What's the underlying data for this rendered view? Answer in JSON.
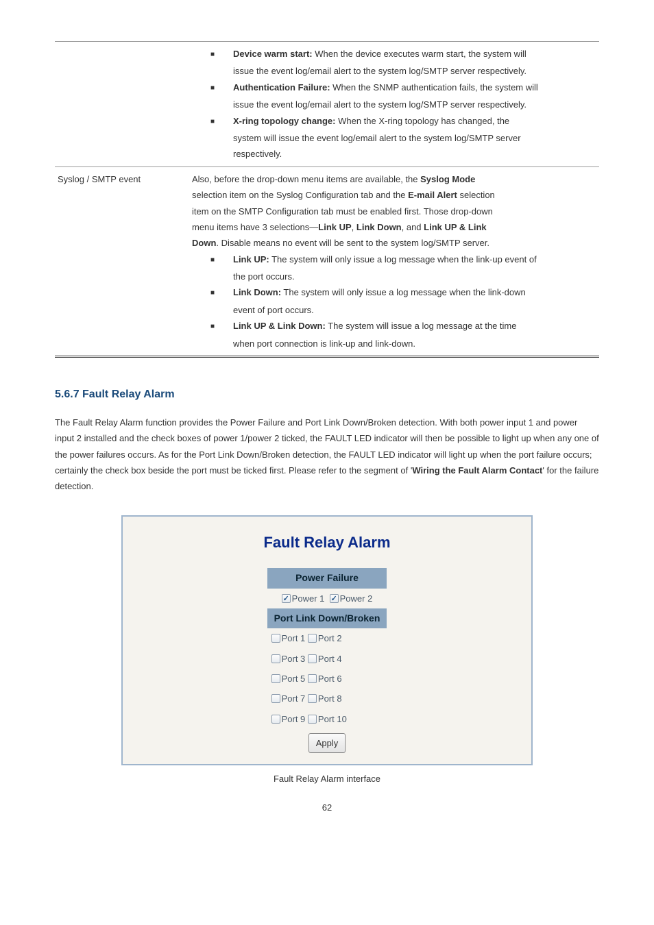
{
  "labelCol1": "",
  "syslogSmtpLabel": "Syslog / SMTP event",
  "row1": {
    "b1_lead": "Device warm start:",
    "b1_tail": " When the device executes warm start, the system will",
    "b1_cont": "issue the event log/email alert to the system log/SMTP server respectively.",
    "b2_lead": "Authentication Failure:",
    "b2_tail": " When the SNMP authentication fails, the system will",
    "b2_cont": "issue the event log/email alert to the system log/SMTP server respectively.",
    "b3_lead": "X-ring topology change:",
    "b3_tail": " When the X-ring topology has changed, the",
    "b3_cont1": "system will issue the event log/email alert to the system log/SMTP server",
    "b3_cont2": "respectively."
  },
  "row2": {
    "p1a": "Also, before the drop-down menu items are available, the ",
    "p1b": "Syslog Mode",
    "p2a": "selection item on the Syslog Configuration tab and the ",
    "p2b": "E-mail Alert",
    "p2c": " selection",
    "p3": "item on the SMTP Configuration tab must be enabled first. Those drop-down",
    "p4a": "menu items have 3 selections—",
    "p4b": "Link UP",
    "p4c": ", ",
    "p4d": "Link Down",
    "p4e": ", and ",
    "p4f": "Link UP & Link",
    "p5a": "Down",
    "p5b": ". Disable means no event will be sent to the system log/SMTP server.",
    "b1_lead": "Link UP:",
    "b1_tail": " The system will only issue a log message when the link-up event of",
    "b1_cont": "the port occurs.",
    "b2_lead": "Link Down:",
    "b2_tail": " The system will only issue a log message when the link-down",
    "b2_cont": "event of port occurs.",
    "b3_lead": "Link UP & Link Down:",
    "b3_tail": " The system will issue a log message at the time",
    "b3_cont": "when port connection is link-up and link-down."
  },
  "heading": "5.6.7 Fault Relay Alarm",
  "bodyPara": {
    "t1": "The Fault Relay Alarm function provides the Power Failure and Port Link Down/Broken detection. With both power input 1 and power input 2 installed and the check boxes of power 1/power 2 ticked, the FAULT LED indicator will then be possible to light up when any one of the power failures occurs. As for the Port Link Down/Broken detection, the FAULT LED indicator will light up when the port failure occurs; certainly the check box beside the port must be ticked first. Please refer to the segment of '",
    "t2": "Wiring the Fault Alarm Contact",
    "t3": "' for the failure detection."
  },
  "shot": {
    "title": "Fault Relay Alarm",
    "h1": "Power Failure",
    "pw1": "Power 1",
    "pw2": "Power 2",
    "h2": "Port Link Down/Broken",
    "ports": [
      [
        "Port 1",
        "Port 2"
      ],
      [
        "Port 3",
        "Port 4"
      ],
      [
        "Port 5",
        "Port 6"
      ],
      [
        "Port 7",
        "Port 8"
      ],
      [
        "Port 9",
        "Port 10"
      ]
    ],
    "apply": "Apply"
  },
  "caption": "Fault Relay Alarm interface",
  "pageNum": "62"
}
